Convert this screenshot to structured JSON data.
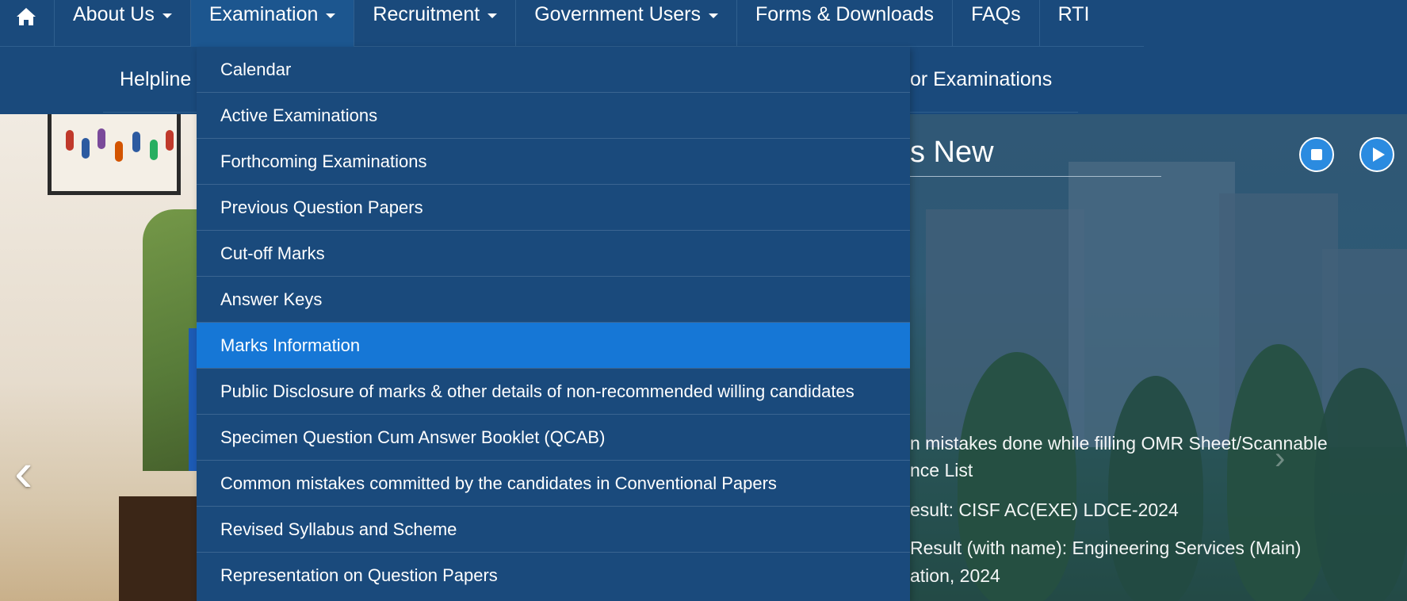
{
  "topnav": {
    "home_icon": "home-icon",
    "items": [
      {
        "label": "About Us",
        "has_caret": true
      },
      {
        "label": "Examination",
        "has_caret": true
      },
      {
        "label": "Recruitment",
        "has_caret": true
      },
      {
        "label": "Government Users",
        "has_caret": true
      },
      {
        "label": "Forms & Downloads",
        "has_caret": false
      },
      {
        "label": "FAQs",
        "has_caret": false
      },
      {
        "label": "RTI",
        "has_caret": false
      }
    ]
  },
  "subnav": {
    "helpline_label": "Helpline",
    "exams_label": "for Examinations"
  },
  "examination_menu": {
    "items": [
      "Calendar",
      "Active Examinations",
      "Forthcoming Examinations",
      "Previous Question Papers",
      "Cut-off Marks",
      "Answer Keys",
      "Marks Information",
      "Public Disclosure of marks & other details of non-recommended willing candidates",
      "Specimen Question Cum Answer Booklet (QCAB)",
      "Common mistakes committed by the candidates in Conventional Papers",
      "Revised Syllabus and Scheme",
      "Representation on Question Papers"
    ],
    "highlighted": "Marks Information"
  },
  "whats_new": {
    "title": "s New",
    "lines": [
      "n mistakes done while filling OMR Sheet/Scannable",
      "nce List",
      "esult: CISF AC(EXE) LDCE-2024",
      "Result (with name): Engineering Services (Main)",
      "ation, 2024"
    ],
    "stop_icon": "stop-icon",
    "play_icon": "play-icon"
  },
  "carousel": {
    "prev_icon": "chevron-left-icon",
    "prev_glyph": "‹",
    "next_glyph": "›"
  },
  "colors": {
    "nav_bg": "#1a4a7c",
    "highlight": "#1677d6",
    "button_blue": "#2b8be0"
  }
}
